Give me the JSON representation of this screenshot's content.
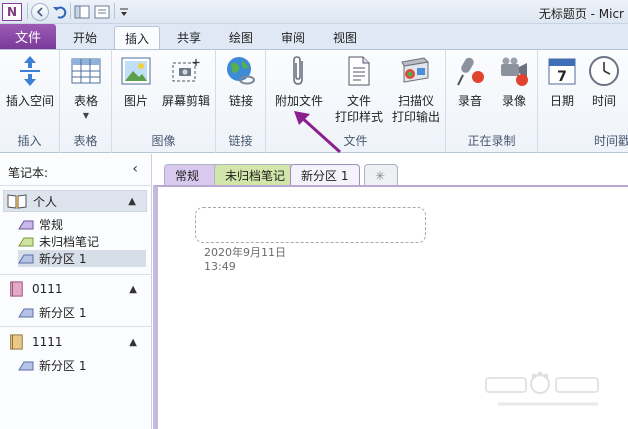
{
  "window": {
    "title": "无标题页 - Micr",
    "app_logo": "N"
  },
  "quick_access": {
    "icons": [
      "onenote-logo-icon",
      "back-icon",
      "undo-icon",
      "view-icon",
      "dock-icon",
      "customize-icon"
    ]
  },
  "ribbon_tabs": {
    "file": "文件",
    "tabs": [
      "开始",
      "插入",
      "共享",
      "绘图",
      "审阅",
      "视图"
    ],
    "active": "插入"
  },
  "ribbon": {
    "groups": [
      {
        "label": "插入",
        "buttons": [
          {
            "label": "插入空间",
            "icon": "insert-space-icon"
          }
        ]
      },
      {
        "label": "表格",
        "buttons": [
          {
            "label": "表格",
            "icon": "table-icon"
          }
        ]
      },
      {
        "label": "图像",
        "buttons": [
          {
            "label": "图片",
            "icon": "picture-icon"
          },
          {
            "label": "屏幕剪辑",
            "icon": "screen-clipping-icon"
          }
        ]
      },
      {
        "label": "链接",
        "buttons": [
          {
            "label": "链接",
            "icon": "link-globe-icon"
          }
        ]
      },
      {
        "label": "文件",
        "buttons": [
          {
            "label": "附加文件",
            "icon": "paperclip-icon"
          },
          {
            "label": "文件",
            "label2": "打印样式",
            "icon": "file-printout-icon"
          },
          {
            "label": "扫描仪",
            "label2": "打印输出",
            "icon": "scanner-printout-icon"
          }
        ]
      },
      {
        "label": "正在录制",
        "buttons": [
          {
            "label": "录音",
            "icon": "record-audio-icon"
          },
          {
            "label": "录像",
            "icon": "record-video-icon"
          }
        ]
      },
      {
        "label": "时间戳",
        "label_visible": "时间戳",
        "buttons": [
          {
            "label": "日期",
            "icon": "calendar-icon",
            "calendar_day": "7"
          },
          {
            "label": "时间",
            "icon": "clock-icon"
          }
        ]
      }
    ]
  },
  "notebook_pane": {
    "header": "笔记本:",
    "collapse_glyph": "‹",
    "notebooks": [
      {
        "name": "个人",
        "sections": [
          "常规",
          "未归档笔记",
          "新分区 1"
        ],
        "selected_section": "新分区 1"
      },
      {
        "name": "0111",
        "sections": [
          "新分区 1"
        ]
      },
      {
        "name": "1111",
        "sections": [
          "新分区 1"
        ]
      }
    ]
  },
  "section_tabs": {
    "tabs": [
      "常规",
      "未归档笔记",
      "新分区 1"
    ],
    "active": "新分区 1",
    "new_tab_glyph": "✳"
  },
  "page": {
    "date": "2020年9月11日",
    "time": "13:49"
  },
  "colors": {
    "file_tab": "#7a3a98",
    "arrow": "#8b1f8d",
    "section_general": "#d9c9ef",
    "section_unfiled": "#d2e6a9",
    "section_new": "#eeeef7"
  }
}
